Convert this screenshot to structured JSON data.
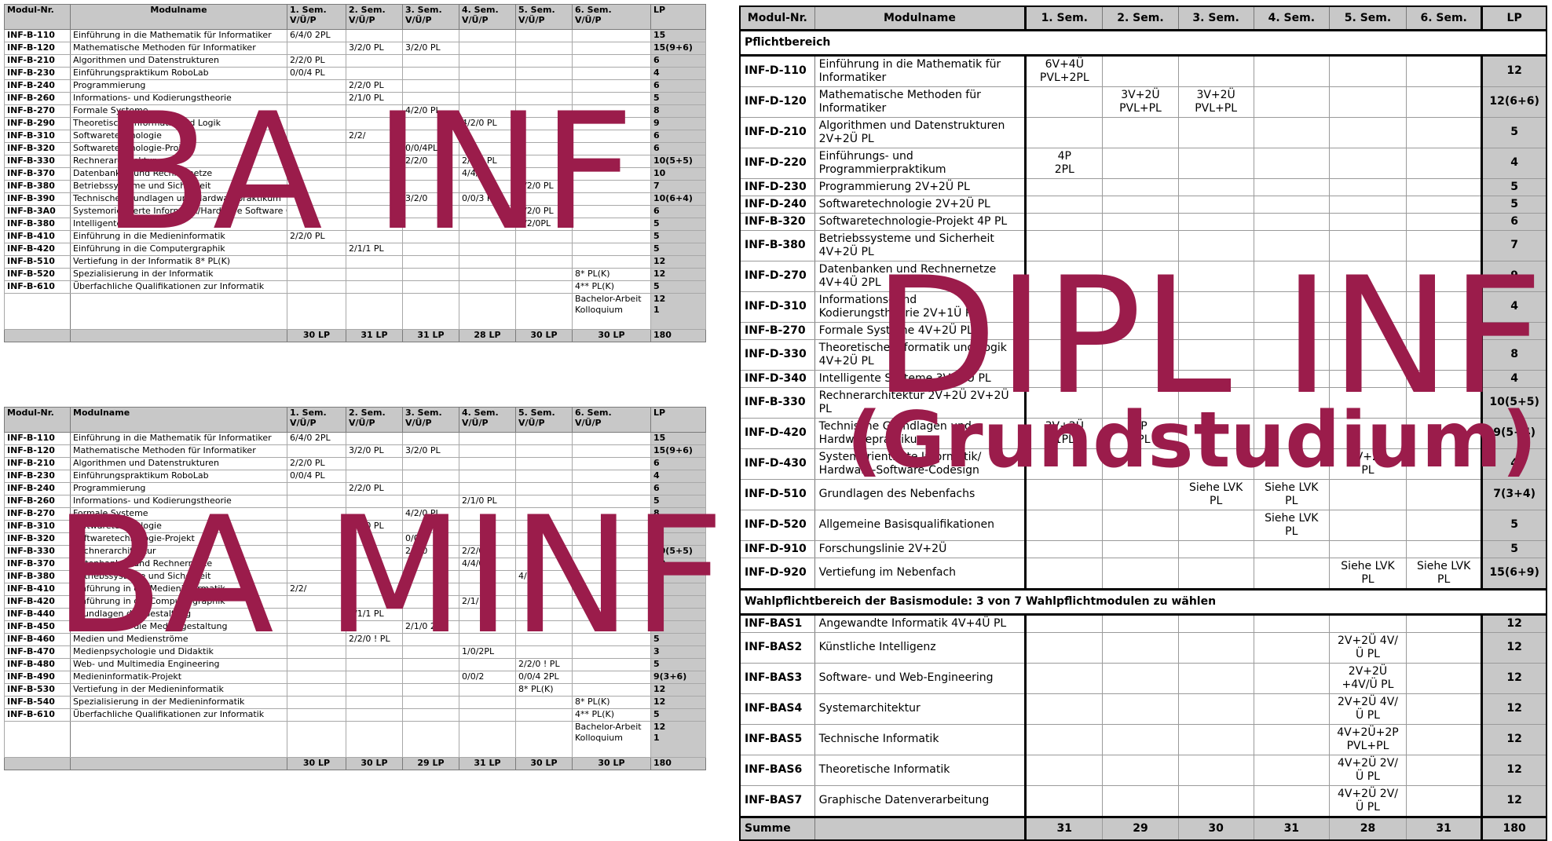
{
  "ba_inf": {
    "headers": [
      "Modul-Nr.",
      "Modulname",
      "1. Sem. V/Ü/P",
      "2. Sem. V/Ü/P",
      "3. Sem. V/Ü/P",
      "4. Sem. V/Ü/P",
      "5. Sem. V/Ü/P",
      "6. Sem. V/Ü/P",
      "LP"
    ],
    "rows": [
      [
        "INF-B-110",
        "Einführung in die Mathematik für Informatiker",
        "6/4/0 2PL",
        "",
        "",
        "",
        "",
        "",
        "15"
      ],
      [
        "INF-B-120",
        "Mathematische Methoden für Informatiker",
        "",
        "3/2/0 PL",
        "3/2/0 PL",
        "",
        "",
        "",
        "15(9+6)"
      ],
      [
        "INF-B-210",
        "Algorithmen und Datenstrukturen",
        "2/2/0 PL",
        "",
        "",
        "",
        "",
        "",
        "6"
      ],
      [
        "INF-B-230",
        "Einführungspraktikum RoboLab",
        "0/0/4 PL",
        "",
        "",
        "",
        "",
        "",
        "4"
      ],
      [
        "INF-B-240",
        "Programmierung",
        "",
        "2/2/0 PL",
        "",
        "",
        "",
        "",
        "6"
      ],
      [
        "INF-B-260",
        "Informations- und Kodierungstheorie",
        "",
        "2/1/0 PL",
        "",
        "",
        "",
        "",
        "5"
      ],
      [
        "INF-B-270",
        "Formale Systeme",
        "",
        "",
        "4/2/0 PL",
        "",
        "",
        "",
        "8"
      ],
      [
        "INF-B-290",
        "Theoretische Informatik und Logik",
        "",
        "",
        "",
        "4/2/0 PL",
        "",
        "",
        "9"
      ],
      [
        "INF-B-310",
        "Softwaretechnologie",
        "",
        "2/2/",
        "",
        "",
        "",
        "",
        "6"
      ],
      [
        "INF-B-320",
        "Softwaretechnologie-Projekt",
        "",
        "",
        "0/0/4PL",
        "",
        "",
        "",
        "6"
      ],
      [
        "INF-B-330",
        "Rechnerarchitektur",
        "",
        "",
        "2/2/0",
        "2/2/0 PL",
        "",
        "",
        "10(5+5)"
      ],
      [
        "INF-B-370",
        "Datenbanken und Rechnernetze",
        "",
        "",
        "",
        "4/4/",
        "",
        "",
        "10"
      ],
      [
        "INF-B-380",
        "Betriebssysteme und Sicherheit",
        "",
        "",
        "",
        "",
        "4/2/0 PL",
        "",
        "7"
      ],
      [
        "INF-B-390",
        "Technische Grundlagen und Hardwarepraktikum",
        "",
        "",
        "3/2/0",
        "0/0/3 PL",
        "",
        "",
        "10(6+4)"
      ],
      [
        "INF-B-3A0",
        "Systemorientierte Informatik/Hardware Software Codesign",
        "",
        "",
        "",
        "",
        "2/2/0 PL",
        "",
        "6"
      ],
      [
        "INF-B-380",
        "Intelligente Systeme",
        "",
        "",
        "",
        "",
        "2/2/0PL",
        "",
        "5"
      ],
      [
        "INF-B-410",
        "Einführung in die Medieninformatik",
        "2/2/0 PL",
        "",
        "",
        "",
        "",
        "",
        "5"
      ],
      [
        "INF-B-420",
        "Einführung in die Computergraphik",
        "",
        "2/1/1 PL",
        "",
        "",
        "",
        "",
        "5"
      ],
      [
        "INF-B-510",
        "Vertiefung in der Informatik 8* PL(K)",
        "",
        "",
        "",
        "",
        "",
        "",
        "12"
      ],
      [
        "INF-B-520",
        "Spezialisierung in der Informatik",
        "",
        "",
        "",
        "",
        "",
        "8* PL(K)",
        "12"
      ],
      [
        "INF-B-610",
        "Überfachliche Qualifikationen zur Informatik",
        "",
        "",
        "",
        "",
        "",
        "4** PL(K)",
        "5"
      ]
    ],
    "thesis": {
      "label": "Bachelor-Arbeit Kolloquium",
      "lp": "12\n1"
    },
    "sums": [
      "30 LP",
      "31 LP",
      "31 LP",
      "28 LP",
      "30 LP",
      "30 LP",
      "180"
    ]
  },
  "ba_minf": {
    "headers": [
      "Modul-Nr.",
      "Modulname",
      "1. Sem. V/Ü/P",
      "2. Sem. V/Ü/P",
      "3. Sem. V/Ü/P",
      "4. Sem. V/Ü/P",
      "5. Sem. V/Ü/P",
      "6. Sem. V/Ü/P",
      "LP"
    ],
    "rows": [
      [
        "INF-B-110",
        "Einführung in die Mathematik für Informatiker",
        "6/4/0 2PL",
        "",
        "",
        "",
        "",
        "",
        "15"
      ],
      [
        "INF-B-120",
        "Mathematische Methoden für Informatiker",
        "",
        "3/2/0 PL",
        "3/2/0 PL",
        "",
        "",
        "",
        "15(9+6)"
      ],
      [
        "INF-B-210",
        "Algorithmen und Datenstrukturen",
        "2/2/0 PL",
        "",
        "",
        "",
        "",
        "",
        "6"
      ],
      [
        "INF-B-230",
        "Einführungspraktikum RoboLab",
        "0/0/4 PL",
        "",
        "",
        "",
        "",
        "",
        "4"
      ],
      [
        "INF-B-240",
        "Programmierung",
        "",
        "2/2/0 PL",
        "",
        "",
        "",
        "",
        "6"
      ],
      [
        "INF-B-260",
        "Informations- und Kodierungstheorie",
        "",
        "",
        "",
        "2/1/0 PL",
        "",
        "",
        "5"
      ],
      [
        "INF-B-270",
        "Formale Systeme",
        "",
        "",
        "4/2/0 PL",
        "",
        "",
        "",
        "8"
      ],
      [
        "INF-B-310",
        "Softwaretechnologie",
        "",
        "2/2/0 PL",
        "",
        "",
        "",
        "",
        "6"
      ],
      [
        "INF-B-320",
        "Softwaretechnologie-Projekt",
        "",
        "",
        "0/0/4",
        "",
        "",
        "",
        "6"
      ],
      [
        "INF-B-330",
        "Rechnerarchitektur",
        "",
        "",
        "2/2/0",
        "2/2/0 P",
        "",
        "",
        "10(5+5)"
      ],
      [
        "INF-B-370",
        "Datenbanken und Rechnernetze",
        "",
        "",
        "",
        "4/4/0PL",
        "",
        "",
        "10"
      ],
      [
        "INF-B-380",
        "Betriebssysteme und Sicherheit",
        "",
        "",
        "",
        "",
        "4/2/",
        "",
        "7"
      ],
      [
        "INF-B-410",
        "Einführung in die Medieninformatik",
        "2/2/",
        "",
        "",
        "",
        "",
        "",
        "5"
      ],
      [
        "INF-B-420",
        "Einführung in die Computergraphik",
        "",
        "",
        "",
        "2/1/",
        "",
        "",
        "5"
      ],
      [
        "INF-B-440",
        "Grundlagen der Gestaltung",
        "",
        "2/1/1 PL",
        "",
        "",
        "",
        "",
        "4"
      ],
      [
        "INF-B-450",
        "Einführung in die Mediengestaltung",
        "",
        "",
        "2/1/0 2PL",
        "",
        "",
        "",
        "4"
      ],
      [
        "INF-B-460",
        "Medien und Medienströme",
        "",
        "2/2/0 ! PL",
        "",
        "",
        "",
        "",
        "5"
      ],
      [
        "INF-B-470",
        "Medienpsychologie und Didaktik",
        "",
        "",
        "",
        "1/0/2PL",
        "",
        "",
        "3"
      ],
      [
        "INF-B-480",
        "Web- und Multimedia Engineering",
        "",
        "",
        "",
        "",
        "2/2/0 ! PL",
        "",
        "5"
      ],
      [
        "INF-B-490",
        "Medieninformatik-Projekt",
        "",
        "",
        "",
        "0/0/2",
        "0/0/4 2PL",
        "",
        "9(3+6)"
      ],
      [
        "INF-B-530",
        "Vertiefung in der Medieninformatik",
        "",
        "",
        "",
        "",
        "8* PL(K)",
        "",
        "12"
      ],
      [
        "INF-B-540",
        "Spezialisierung in der Medieninformatik",
        "",
        "",
        "",
        "",
        "",
        "8* PL(K)",
        "12"
      ],
      [
        "INF-B-610",
        "Überfachliche Qualifikationen zur Informatik",
        "",
        "",
        "",
        "",
        "",
        "4** PL(K)",
        "5"
      ]
    ],
    "thesis": {
      "label": "Bachelor-Arbeit Kolloquium",
      "lp": "12\n1"
    },
    "sums": [
      "30 LP",
      "30 LP",
      "29 LP",
      "31 LP",
      "30 LP",
      "30 LP",
      "180"
    ]
  },
  "dipl": {
    "headers": [
      "Modul-Nr.",
      "Modulname",
      "1. Sem.",
      "2. Sem.",
      "3. Sem.",
      "4. Sem.",
      "5. Sem.",
      "6. Sem.",
      "LP"
    ],
    "section_pflicht": "Pflichtbereich",
    "pflicht_rows": [
      [
        "INF-D-110",
        "Einführung in die Mathematik für Informatiker",
        "6V+4Ü\nPVL+2PL",
        "",
        "",
        "",
        "",
        "",
        "12"
      ],
      [
        "INF-D-120",
        "Mathematische Methoden für Informatiker",
        "",
        "3V+2Ü\nPVL+PL",
        "3V+2Ü\nPVL+PL",
        "",
        "",
        "",
        "12(6+6)"
      ],
      [
        "INF-D-210",
        "Algorithmen und Datenstrukturen 2V+2Ü PL",
        "",
        "",
        "",
        "",
        "",
        "",
        "5"
      ],
      [
        "INF-D-220",
        "Einführungs- und Programmierpraktikum",
        "4P\n2PL",
        "",
        "",
        "",
        "",
        "",
        "4"
      ],
      [
        "INF-D-230",
        "Programmierung 2V+2Ü PL",
        "",
        "",
        "",
        "",
        "",
        "",
        "5"
      ],
      [
        "INF-D-240",
        "Softwaretechnologie 2V+2Ü PL",
        "",
        "",
        "",
        "",
        "",
        "",
        "5"
      ],
      [
        "INF-B-320",
        "Softwaretechnologie-Projekt 4P PL",
        "",
        "",
        "",
        "",
        "",
        "",
        "6"
      ],
      [
        "INF-B-380",
        "Betriebssysteme und Sicherheit 4V+2Ü PL",
        "",
        "",
        "",
        "",
        "",
        "",
        "7"
      ],
      [
        "INF-D-270",
        "Datenbanken und Rechnernetze 4V+4Ü 2PL",
        "",
        "",
        "",
        "",
        "",
        "",
        "9"
      ],
      [
        "INF-D-310",
        "Informations- und Kodierungstheorie 2V+1Ü PL",
        "",
        "",
        "",
        "",
        "",
        "",
        "4"
      ],
      [
        "INF-B-270",
        "Formale Systeme 4V+2Ü PL",
        "",
        "",
        "",
        "",
        "",
        "",
        "8"
      ],
      [
        "INF-D-330",
        "Theoretische Informatik und Logik 4V+2Ü PL",
        "",
        "",
        "",
        "",
        "",
        "",
        "8"
      ],
      [
        "INF-D-340",
        "Intelligente Systeme 3V+1Ü PL",
        "",
        "",
        "",
        "",
        "",
        "",
        "4"
      ],
      [
        "INF-B-330",
        "Rechnerarchitektur 2V+2Ü 2V+2Ü PL",
        "",
        "",
        "",
        "",
        "",
        "",
        "10(5+5)"
      ],
      [
        "INF-D-420",
        "Technische Grundlagen und Hardwarepraktikum",
        "3V+2Ü\n1PL",
        "3P\n1PL",
        "",
        "",
        "",
        "",
        "9(5+4)"
      ],
      [
        "INF-D-430",
        "Systemorientierte Informatik/ Hardware-Software-Codesign",
        "",
        "",
        "",
        "",
        "2V+2Ü\nPL",
        "",
        "4"
      ],
      [
        "INF-D-510",
        "Grundlagen des Nebenfachs",
        "",
        "",
        "Siehe LVK\nPL",
        "Siehe LVK\nPL",
        "",
        "",
        "7(3+4)"
      ],
      [
        "INF-D-520",
        "Allgemeine Basisqualifikationen",
        "",
        "",
        "",
        "Siehe LVK\nPL",
        "",
        "",
        "5"
      ],
      [
        "INF-D-910",
        "Forschungslinie 2V+2Ü",
        "",
        "",
        "",
        "",
        "",
        "",
        "5"
      ],
      [
        "INF-D-920",
        "Vertiefung im Nebenfach",
        "",
        "",
        "",
        "",
        "Siehe LVK\nPL",
        "Siehe LVK\nPL",
        "15(6+9)"
      ]
    ],
    "section_wahl": "Wahlpflichtbereich der Basismodule: 3 von 7 Wahlpflichtmodulen zu wählen",
    "wahl_rows": [
      [
        "INF-BAS1",
        "Angewandte Informatik 4V+4Ü PL",
        "",
        "",
        "",
        "",
        "",
        "",
        "12"
      ],
      [
        "INF-BAS2",
        "Künstliche Intelligenz",
        "",
        "",
        "",
        "",
        "2V+2Ü 4V/Ü PL",
        "",
        "12"
      ],
      [
        "INF-BAS3",
        "Software- und Web-Engineering",
        "",
        "",
        "",
        "",
        "2V+2Ü\n+4V/Ü PL",
        "",
        "12"
      ],
      [
        "INF-BAS4",
        "Systemarchitektur",
        "",
        "",
        "",
        "",
        "2V+2Ü 4V/Ü PL",
        "",
        "12"
      ],
      [
        "INF-BAS5",
        "Technische Informatik",
        "",
        "",
        "",
        "",
        "4V+2Ü+2P\nPVL+PL",
        "",
        "12"
      ],
      [
        "INF-BAS6",
        "Theoretische Informatik",
        "",
        "",
        "",
        "",
        "4V+2Ü 2V/Ü PL",
        "",
        "12"
      ],
      [
        "INF-BAS7",
        "Graphische Datenverarbeitung",
        "",
        "",
        "",
        "",
        "4V+2Ü 2V/Ü PL",
        "",
        "12"
      ]
    ],
    "sum_label": "Summe",
    "sums": [
      "31",
      "29",
      "30",
      "31",
      "28",
      "31",
      "180"
    ]
  },
  "watermarks": {
    "ba_inf": "BA INF",
    "ba_minf": "BA MINF",
    "dipl_main": "DIPL INF",
    "dipl_sub": "(Grundstudium)"
  },
  "colors": {
    "watermark": "#9b1c4b",
    "header_bg": "#c8c8c8"
  }
}
